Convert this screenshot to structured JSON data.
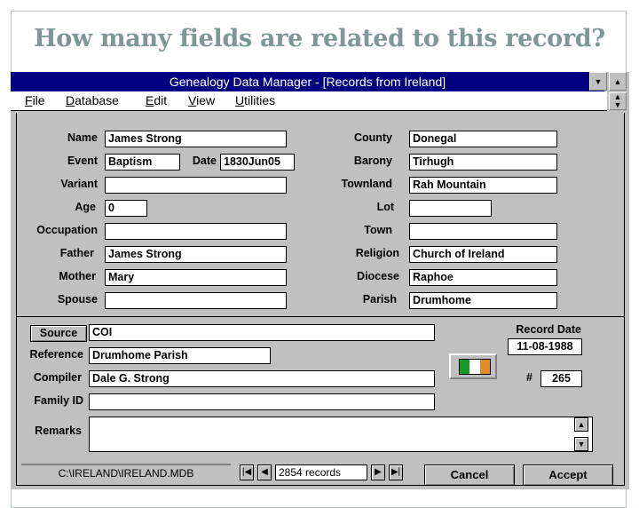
{
  "slide": {
    "title": "How many fields are related to this record?"
  },
  "window": {
    "title": "Genealogy Data Manager - [Records from Ireland]",
    "controls": {
      "minimize_glyph": "▼",
      "maximize_glyph": "▲",
      "restore_glyph": "▲▼"
    }
  },
  "menu": {
    "items": [
      {
        "key": "F",
        "rest": "ile"
      },
      {
        "key": "D",
        "rest": "atabase"
      },
      {
        "key": "E",
        "rest": "dit"
      },
      {
        "key": "V",
        "rest": "iew"
      },
      {
        "key": "U",
        "rest": "tilities"
      }
    ]
  },
  "form": {
    "left": {
      "name": {
        "label": "Name",
        "value": "James Strong"
      },
      "event": {
        "label": "Event",
        "value": "Baptism"
      },
      "date": {
        "label": "Date",
        "value": "1830Jun05"
      },
      "variant": {
        "label": "Variant",
        "value": ""
      },
      "age": {
        "label": "Age",
        "value": "0"
      },
      "occupation": {
        "label": "Occupation",
        "value": ""
      },
      "father": {
        "label": "Father",
        "value": "James Strong"
      },
      "mother": {
        "label": "Mother",
        "value": "Mary"
      },
      "spouse": {
        "label": "Spouse",
        "value": ""
      }
    },
    "right": {
      "county": {
        "label": "County",
        "value": "Donegal"
      },
      "barony": {
        "label": "Barony",
        "value": "Tirhugh"
      },
      "townland": {
        "label": "Townland",
        "value": "Rah Mountain"
      },
      "lot": {
        "label": "Lot",
        "value": ""
      },
      "town": {
        "label": "Town",
        "value": ""
      },
      "religion": {
        "label": "Religion",
        "value": "Church of Ireland"
      },
      "diocese": {
        "label": "Diocese",
        "value": "Raphoe"
      },
      "parish": {
        "label": "Parish",
        "value": "Drumhome"
      }
    },
    "bottom": {
      "source": {
        "button_label": "Source",
        "value": "COI"
      },
      "reference": {
        "label": "Reference",
        "value": "Drumhome Parish"
      },
      "compiler": {
        "label": "Compiler",
        "value": "Dale G. Strong"
      },
      "family_id": {
        "label": "Family ID",
        "value": ""
      },
      "remarks": {
        "label": "Remarks",
        "value": ""
      },
      "record_date": {
        "label": "Record Date",
        "value": "11-08-1988"
      },
      "record_number": {
        "label": "#",
        "value": "265"
      }
    },
    "flag_colors": {
      "green": "#169b28",
      "white": "#ffffff",
      "orange": "#e08a2a"
    }
  },
  "status": {
    "path": "C:\\IRELAND\\IRELAND.MDB",
    "record_count": "2854 records",
    "nav": {
      "first": "|◀",
      "prev": "◀",
      "next": "▶",
      "last": "▶|"
    }
  },
  "buttons": {
    "cancel": "Cancel",
    "accept": "Accept"
  }
}
